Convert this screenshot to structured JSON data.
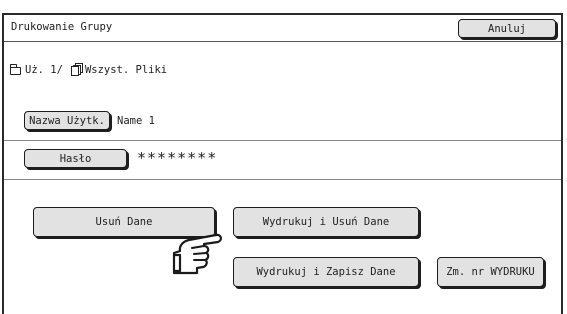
{
  "header": {
    "title": "Drukowanie Grupy",
    "cancel_label": "Anuluj"
  },
  "path": {
    "user_segment": "Uż. 1/",
    "folder_label": "Wszyst. Pliki"
  },
  "user": {
    "button_label": "Nazwa Użytk.",
    "value": "Name 1"
  },
  "password": {
    "button_label": "Hasło",
    "value": "********"
  },
  "actions": {
    "delete_label": "Usuń Dane",
    "print_delete_label": "Wydrukuj i Usuń Dane",
    "print_save_label": "Wydrukuj i Zapisz Dane",
    "change_print_count_label": "Zm. nr WYDRUKU"
  },
  "icons": {
    "folder": "folder-icon",
    "files": "files-icon",
    "pointer": "pointing-hand-icon"
  }
}
